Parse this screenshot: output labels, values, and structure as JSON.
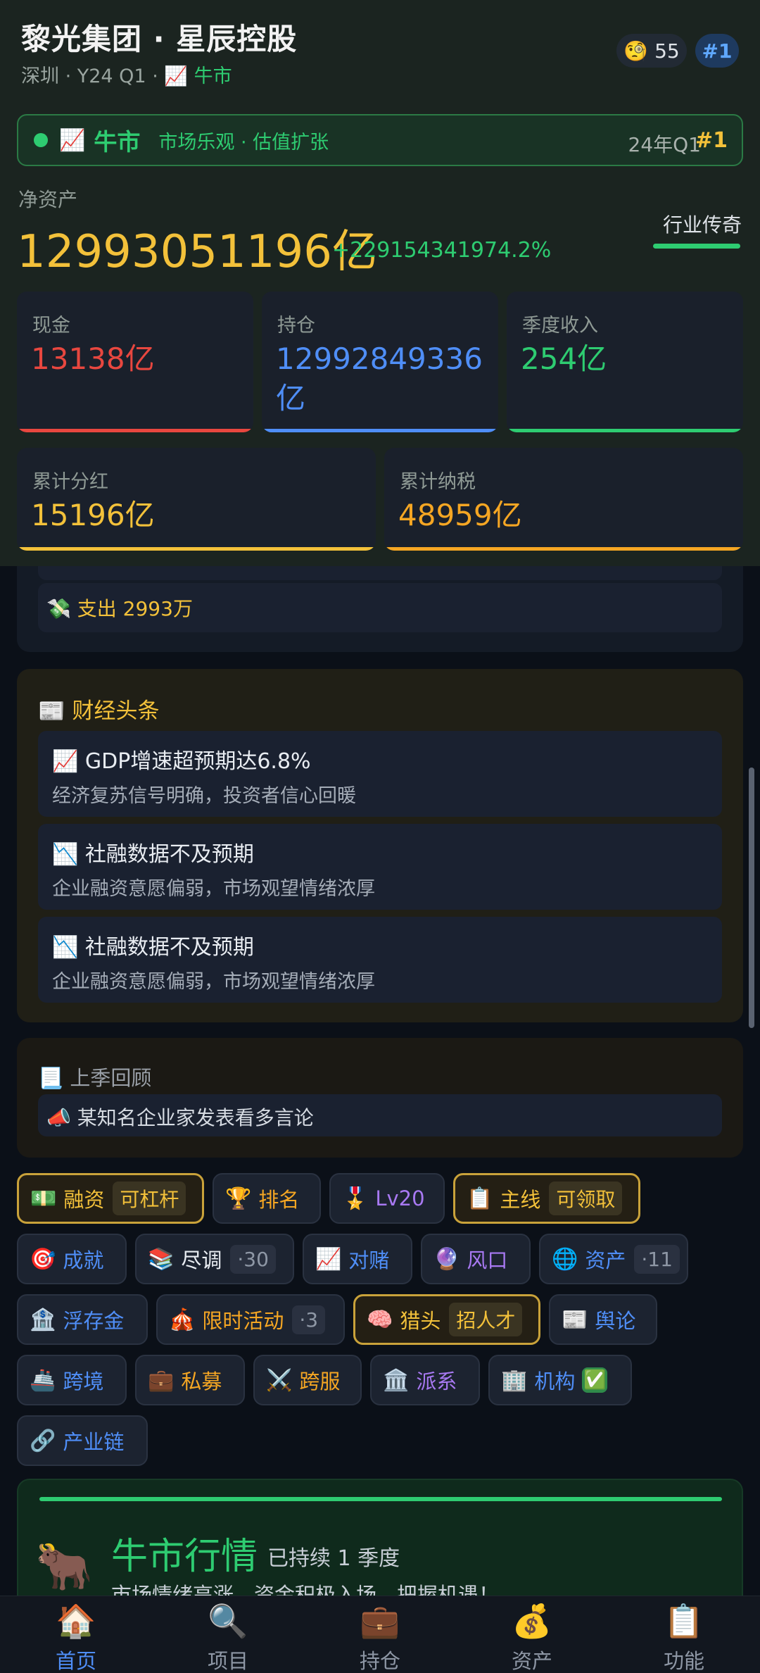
{
  "header": {
    "title": "黎光集团 · 星辰控股",
    "city": "深圳",
    "quarter": "Y24 Q1",
    "market_emoji": "📈",
    "market_label": "牛市",
    "coin_emoji": "🧐",
    "coin_count": "55",
    "rank_badge": "#1"
  },
  "market_bar": {
    "emoji": "📈",
    "name": "牛市",
    "desc": "市场乐观 · 估值扩张",
    "quarter": "24年Q1",
    "rank": "#1"
  },
  "net_worth": {
    "label": "净资产",
    "value": "12993051196亿",
    "change": "+229154341974.2%",
    "level_title": "行业传奇"
  },
  "stats": {
    "cash": {
      "label": "现金",
      "value": "13138亿"
    },
    "holdings": {
      "label": "持仓",
      "value": "12992849336亿"
    },
    "quarter_income": {
      "label": "季度收入",
      "value": "254亿"
    },
    "dividends": {
      "label": "累计分红",
      "value": "15196亿"
    },
    "tax": {
      "label": "累计纳税",
      "value": "48959亿"
    }
  },
  "expense": {
    "emoji": "💸",
    "text": "支出 2993万"
  },
  "news": {
    "emoji": "📰",
    "title": "财经头条",
    "items": [
      {
        "emoji": "📈",
        "headline": "GDP增速超预期达6.8%",
        "body": "经济复苏信号明确，投资者信心回暖"
      },
      {
        "emoji": "📉",
        "headline": "社融数据不及预期",
        "body": "企业融资意愿偏弱，市场观望情绪浓厚"
      },
      {
        "emoji": "📉",
        "headline": "社融数据不及预期",
        "body": "企业融资意愿偏弱，市场观望情绪浓厚"
      }
    ]
  },
  "review": {
    "emoji": "📃",
    "title": "上季回顾",
    "item_emoji": "📣",
    "item": "某知名企业家发表看多言论"
  },
  "features": {
    "financing": {
      "emoji": "💵",
      "label": "融资",
      "tag": "可杠杆"
    },
    "ranking": {
      "emoji": "🏆",
      "label": "排名"
    },
    "level": {
      "emoji": "🎖️",
      "label": "Lv20"
    },
    "mainline": {
      "emoji": "📋",
      "label": "主线",
      "tag": "可领取"
    },
    "achievement": {
      "emoji": "🎯",
      "label": "成就"
    },
    "due_diligence": {
      "emoji": "📚",
      "label": "尽调",
      "count": "·30"
    },
    "bet": {
      "emoji": "📈",
      "label": "对赌"
    },
    "trend": {
      "emoji": "🔮",
      "label": "风口"
    },
    "assets": {
      "emoji": "🌐",
      "label": "资产",
      "count": "·11"
    },
    "float": {
      "emoji": "🏦",
      "label": "浮存金"
    },
    "event": {
      "emoji": "🎪",
      "label": "限时活动",
      "count": "·3"
    },
    "headhunter": {
      "emoji": "🧠",
      "label": "猎头",
      "tag": "招人才"
    },
    "opinion": {
      "emoji": "📰",
      "label": "舆论"
    },
    "crossborder": {
      "emoji": "🚢",
      "label": "跨境"
    },
    "private_equity": {
      "emoji": "💼",
      "label": "私募"
    },
    "crossserver": {
      "emoji": "⚔️",
      "label": "跨服"
    },
    "faction": {
      "emoji": "🏛️",
      "label": "派系"
    },
    "institution": {
      "emoji": "🏢",
      "label": "机构",
      "check": "✅"
    },
    "industry_chain": {
      "emoji": "🔗",
      "label": "产业链"
    }
  },
  "bull_market": {
    "emoji": "🐂",
    "title": "牛市行情",
    "duration": "已持续 1 季度",
    "desc": "市场情绪高涨，资金积极入场，把握机遇！"
  },
  "nav": {
    "home": {
      "emoji": "🏠",
      "label": "首页"
    },
    "projects": {
      "emoji": "🔍",
      "label": "项目"
    },
    "holdings": {
      "emoji": "💼",
      "label": "持仓"
    },
    "assets": {
      "emoji": "💰",
      "label": "资产"
    },
    "functions": {
      "emoji": "📋",
      "label": "功能"
    }
  },
  "colors": {
    "gold": "#f3c13a",
    "green": "#2ecc71",
    "red": "#e8473f",
    "blue": "#4f8ef7",
    "orange": "#f5a623"
  }
}
